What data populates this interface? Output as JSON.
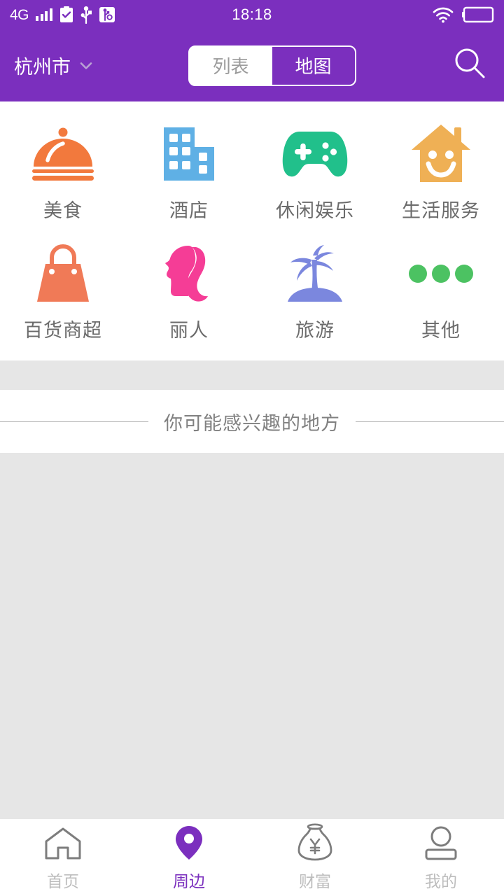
{
  "theme": {
    "accent": "#7B2FBE",
    "page_bg": "#e6e6e6",
    "card_bg": "#ffffff",
    "muted_text": "#9b9b9b"
  },
  "status_bar": {
    "network": "4G",
    "signal_bars": 4,
    "time": "18:18",
    "icons": [
      "clipboard-check-icon",
      "usb-icon",
      "usb-debug-icon",
      "wifi-icon",
      "battery-icon"
    ]
  },
  "header": {
    "city": "杭州市",
    "city_chevron": "chevron-down-icon",
    "search_icon": "search-icon",
    "segmented": {
      "options": [
        "列表",
        "地图"
      ],
      "selected": "地图"
    }
  },
  "categories": [
    {
      "label": "美食",
      "icon": "food-cloche-icon",
      "color": "#F2793D"
    },
    {
      "label": "酒店",
      "icon": "hotel-building-icon",
      "color": "#5FB0E5"
    },
    {
      "label": "休闲娱乐",
      "icon": "gamepad-icon",
      "color": "#21C08B"
    },
    {
      "label": "生活服务",
      "icon": "smiling-house-icon",
      "color": "#EFB055"
    },
    {
      "label": "百货商超",
      "icon": "shopping-bag-icon",
      "color": "#F07A57"
    },
    {
      "label": "丽人",
      "icon": "woman-profile-icon",
      "color": "#F53D96"
    },
    {
      "label": "旅游",
      "icon": "palm-island-icon",
      "color": "#7B87DE"
    },
    {
      "label": "其他",
      "icon": "more-dots-icon",
      "color": "#4CC262"
    }
  ],
  "section": {
    "title": "你可能感兴趣的地方"
  },
  "tabbar": {
    "items": [
      {
        "label": "首页",
        "icon": "home-icon",
        "active": false
      },
      {
        "label": "周边",
        "icon": "map-pin-icon",
        "active": true
      },
      {
        "label": "财富",
        "icon": "money-bag-icon",
        "active": false
      },
      {
        "label": "我的",
        "icon": "person-icon",
        "active": false
      }
    ]
  }
}
